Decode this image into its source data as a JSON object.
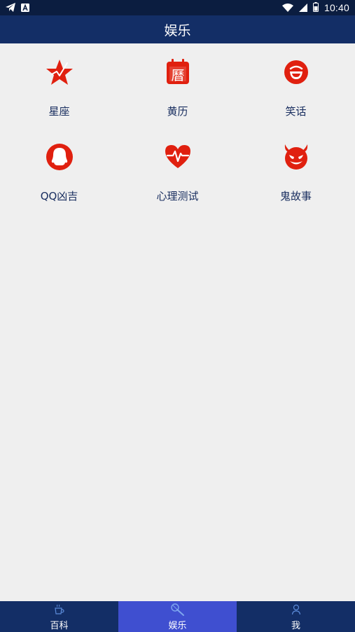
{
  "status_bar": {
    "time": "10:40",
    "left_icons": [
      "telegram-icon",
      "a-square-icon"
    ],
    "right_icons": [
      "wifi-icon",
      "signal-icon",
      "battery-icon"
    ]
  },
  "header": {
    "title": "娱乐"
  },
  "grid": {
    "items": [
      {
        "label": "星座",
        "icon": "star-icon"
      },
      {
        "label": "黄历",
        "icon": "calendar-icon"
      },
      {
        "label": "笑话",
        "icon": "smile-icon"
      },
      {
        "label": "QQ凶吉",
        "icon": "qq-penguin-icon"
      },
      {
        "label": "心理测试",
        "icon": "heartbeat-icon"
      },
      {
        "label": "鬼故事",
        "icon": "devil-icon"
      }
    ]
  },
  "tabbar": {
    "tabs": [
      {
        "label": "百科",
        "icon": "cup-icon",
        "active": false
      },
      {
        "label": "娱乐",
        "icon": "microphone-icon",
        "active": true
      },
      {
        "label": "我",
        "icon": "person-icon",
        "active": false
      }
    ]
  },
  "colors": {
    "status_bar": "#0b1d40",
    "title_bar": "#132e66",
    "tab_active": "#3f4fd0",
    "icon_red": "#e0200f",
    "label_text": "#1a2f60",
    "background": "#efefef"
  }
}
